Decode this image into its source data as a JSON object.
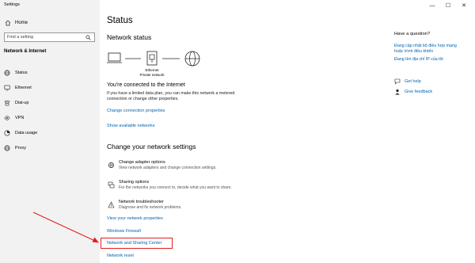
{
  "app": {
    "title": "Settings"
  },
  "sidebar": {
    "home_label": "Home",
    "search_placeholder": "Find a setting",
    "section_title": "Network & Internet",
    "items": [
      {
        "label": "Status",
        "icon": "globe-icon"
      },
      {
        "label": "Ethernet",
        "icon": "ethernet-icon"
      },
      {
        "label": "Dial-up",
        "icon": "dialup-icon"
      },
      {
        "label": "VPN",
        "icon": "vpn-icon"
      },
      {
        "label": "Data usage",
        "icon": "data-usage-icon"
      },
      {
        "label": "Proxy",
        "icon": "proxy-icon"
      }
    ]
  },
  "window_controls": {
    "minimize": "—",
    "maximize": "☐",
    "close": "✕"
  },
  "main": {
    "page_title": "Status",
    "network_status_heading": "Network status",
    "diagram": {
      "adapter_label": "Ethernet",
      "network_label": "Private network"
    },
    "connected_heading": "You're connected to the Internet",
    "connected_text": "If you have a limited data plan, you can make this network a metered connection or change other properties.",
    "change_properties_link": "Change connection properties",
    "show_networks_link": "Show available networks",
    "change_settings_heading": "Change your network settings",
    "options": [
      {
        "title": "Change adapter options",
        "desc": "View network adapters and change connection settings.",
        "icon": "adapter-icon"
      },
      {
        "title": "Sharing options",
        "desc": "For the networks you connect to, decide what you want to share.",
        "icon": "sharing-icon"
      },
      {
        "title": "Network troubleshooter",
        "desc": "Diagnose and fix network problems.",
        "icon": "warning-icon"
      }
    ],
    "view_properties_link": "View your network properties",
    "firewall_link": "Windows Firewall",
    "sharing_center_link": "Network and Sharing Center",
    "reset_link": "Network reset"
  },
  "right_panel": {
    "question_heading": "Have a question?",
    "links": [
      "Đang cập nhật bộ điều hợp mạng hoặc trình điều khiển",
      "Đang tìm địa chỉ IP của tôi"
    ],
    "get_help": "Get help",
    "give_feedback": "Give feedback"
  },
  "colors": {
    "link": "#0063b1",
    "highlight": "#e01d1d",
    "sidebar_bg": "#f2f2f2"
  }
}
